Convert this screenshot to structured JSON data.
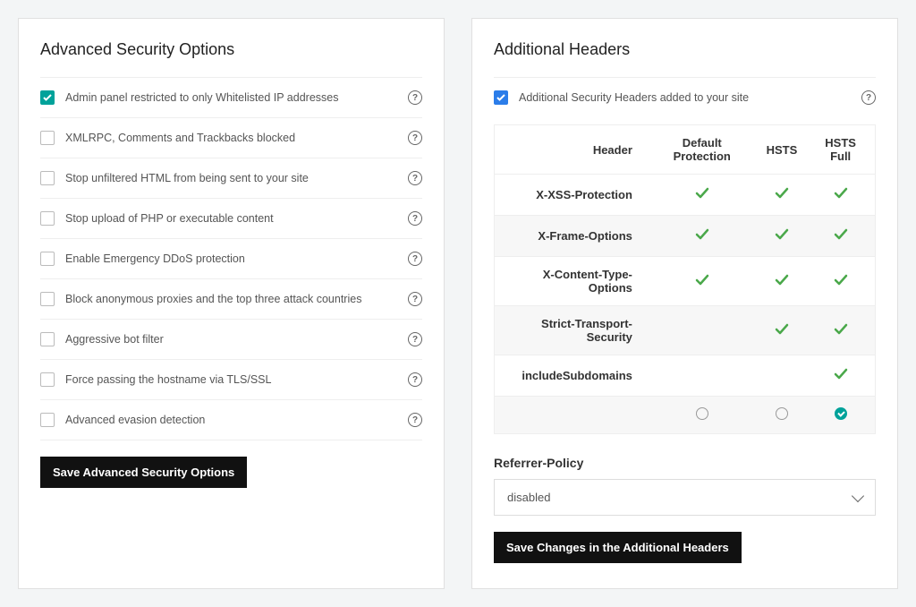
{
  "left": {
    "title": "Advanced Security Options",
    "options": [
      {
        "label": "Admin panel restricted to only Whitelisted IP addresses",
        "checked": true
      },
      {
        "label": "XMLRPC, Comments and Trackbacks blocked",
        "checked": false
      },
      {
        "label": "Stop unfiltered HTML from being sent to your site",
        "checked": false
      },
      {
        "label": "Stop upload of PHP or executable content",
        "checked": false
      },
      {
        "label": "Enable Emergency DDoS protection",
        "checked": false
      },
      {
        "label": "Block anonymous proxies and the top three attack countries",
        "checked": false
      },
      {
        "label": "Aggressive bot filter",
        "checked": false
      },
      {
        "label": "Force passing the hostname via TLS/SSL",
        "checked": false
      },
      {
        "label": "Advanced evasion detection",
        "checked": false
      }
    ],
    "save_label": "Save Advanced Security Options"
  },
  "right": {
    "title": "Additional Headers",
    "enable_label": "Additional Security Headers added to your site",
    "enable_checked": true,
    "table": {
      "headers": [
        "Header",
        "Default Protection",
        "HSTS",
        "HSTS Full"
      ],
      "rows": [
        {
          "name": "X-XSS-Protection",
          "cols": [
            true,
            true,
            true
          ]
        },
        {
          "name": "X-Frame-Options",
          "cols": [
            true,
            true,
            true
          ]
        },
        {
          "name": "X-Content-Type-Options",
          "cols": [
            true,
            true,
            true
          ]
        },
        {
          "name": "Strict-Transport-Security",
          "cols": [
            false,
            true,
            true
          ]
        },
        {
          "name": "includeSubdomains",
          "cols": [
            false,
            false,
            true
          ]
        }
      ],
      "selected_col": 2
    },
    "referrer_label": "Referrer-Policy",
    "referrer_value": "disabled",
    "save_label": "Save Changes in the Additional Headers"
  }
}
